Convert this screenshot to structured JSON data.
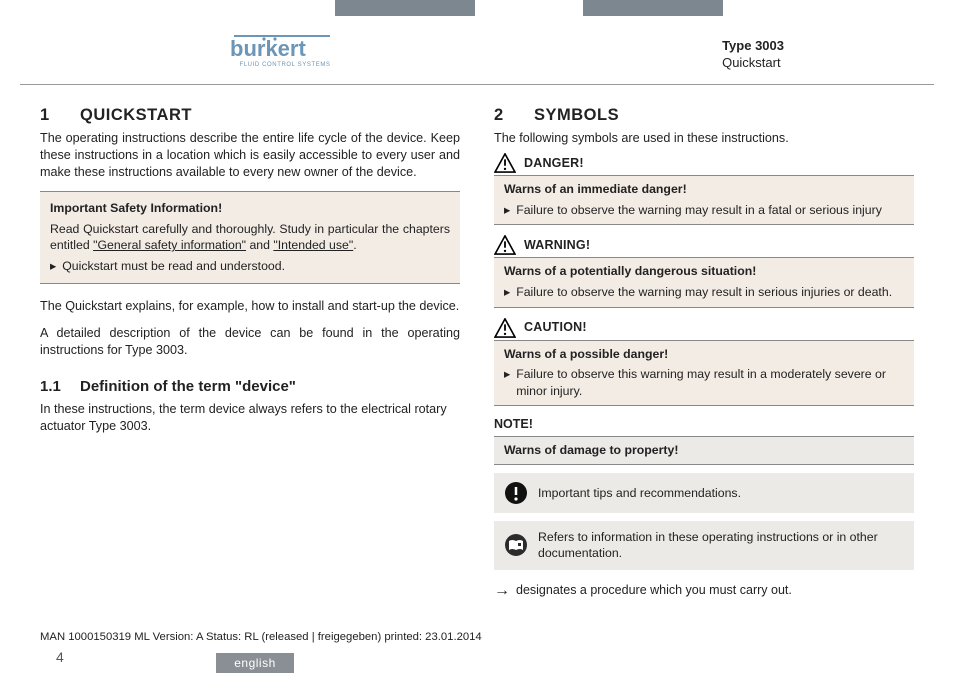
{
  "header": {
    "brand": "burkert",
    "brand_sub": "FLUID CONTROL SYSTEMS",
    "type_label": "Type 3003",
    "subtitle": "Quickstart"
  },
  "left": {
    "sec_num": "1",
    "sec_title": "QUICKSTART",
    "p1": "The operating instructions describe the entire life cycle of the device. Keep these instructions in a location which is easily accessible to every user and make these instructions available to every new owner of the device.",
    "infobox": {
      "title": "Important Safety Information!",
      "body_pre": "Read Quickstart carefully and thoroughly. Study in particular the chapters entitled ",
      "link1": "\"General safety information\"",
      "mid": " and ",
      "link2": "\"Intended use\"",
      "end": ".",
      "bullet": "Quickstart must be read and understood."
    },
    "p2": "The Quickstart explains, for example, how to install and start-up the device.",
    "p3": "A detailed description of the device can be found in the operating instructions for Type 3003.",
    "sub_num": "1.1",
    "sub_title": "Definition of the term \"device\"",
    "p4": "In these instructions, the term device always refers to the electrical rotary actuator Type 3003."
  },
  "right": {
    "sec_num": "2",
    "sec_title": "SYMBOLS",
    "intro": "The following symbols are used in these instructions.",
    "danger": {
      "label": "DANGER!",
      "title": "Warns of an immediate danger!",
      "bullet": "Failure to observe the warning may result in a fatal or serious injury"
    },
    "warning": {
      "label": "WARNING!",
      "title": "Warns of a potentially dangerous situation!",
      "bullet": "Failure to observe the warning may result in serious injuries or death."
    },
    "caution": {
      "label": "CAUTION!",
      "title": "Warns of a possible danger!",
      "bullet": "Failure to observe this warning may result in a moderately severe or minor injury."
    },
    "note": {
      "label": "NOTE!",
      "title": "Warns of damage to property!"
    },
    "tip": "Important tips and recommendations.",
    "ref": "Refers to information in these operating instructions or in other documentation.",
    "proc": "designates a procedure which you must carry out."
  },
  "footer": {
    "meta": "MAN 1000150319 ML Version: A Status: RL (released | freigegeben) printed: 23.01.2014",
    "page": "4",
    "lang": "english"
  },
  "glyph": {
    "tri_arrow": "▸",
    "long_arrow": "→"
  }
}
